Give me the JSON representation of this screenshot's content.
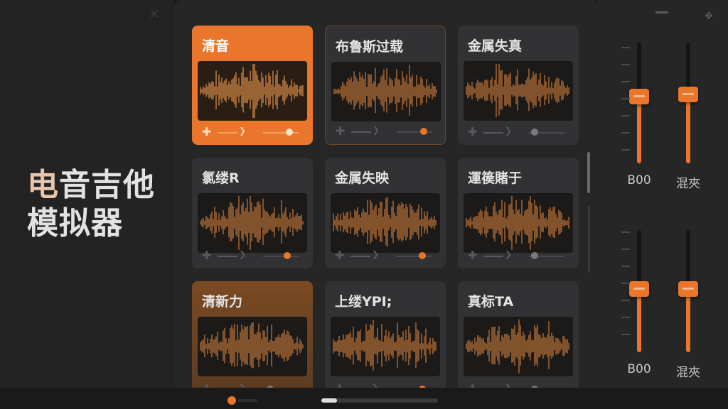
{
  "app": {
    "title_line1": "电音吉他",
    "title_line2": "模拟器"
  },
  "colors": {
    "accent": "#e9762a",
    "background": "#1c1c1d",
    "card": "#323234",
    "waveform": "#c7793a"
  },
  "icons": {
    "close": "close-icon",
    "minimize": "minimize-icon",
    "move": "move-icon"
  },
  "presets": [
    {
      "label": "清音",
      "state": "active"
    },
    {
      "label": "布鲁斯过载",
      "state": "outlined"
    },
    {
      "label": "金属失真",
      "state": "normal"
    },
    {
      "label": "氯缕R",
      "state": "normal"
    },
    {
      "label": "金属失映",
      "state": "normal"
    },
    {
      "label": "運篌賭于",
      "state": "normal"
    },
    {
      "label": "清新力",
      "state": "warm"
    },
    {
      "label": "上缕YPI;",
      "state": "normal"
    },
    {
      "label": "真标TA",
      "state": "normal"
    }
  ],
  "sliders": [
    {
      "label": "B00",
      "level": 0.55
    },
    {
      "label": "混夾",
      "level": 0.57
    },
    {
      "label": "B00",
      "level": 0.52
    },
    {
      "label": "混夾",
      "level": 0.52
    }
  ]
}
